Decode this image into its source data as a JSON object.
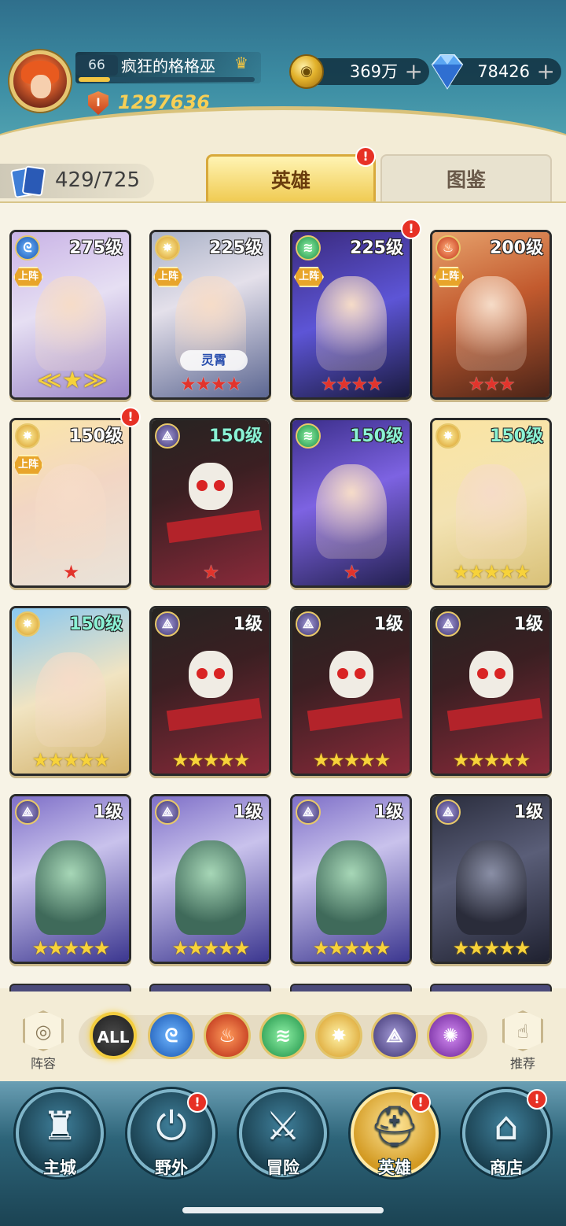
{
  "player": {
    "level": "66",
    "name": "疯狂的格格巫",
    "power": "1297636",
    "exp_fraction": 0.18
  },
  "currency": {
    "gold": "369万",
    "gems": "78426",
    "plus": "+"
  },
  "collection": {
    "count": "429/725"
  },
  "tabs": {
    "heroes": "英雄",
    "codex": "图鉴"
  },
  "badge": "!",
  "deploy_label": "上阵",
  "heroes": [
    {
      "level": "275级",
      "element": "water",
      "deployed": true,
      "stars": "",
      "star_color": "gold",
      "special": "wings",
      "alert": false
    },
    {
      "level": "225级",
      "element": "light",
      "deployed": true,
      "stars": "★★★★",
      "star_color": "red",
      "title": "灵霄",
      "alert": false
    },
    {
      "level": "225级",
      "element": "wind",
      "deployed": true,
      "stars": "★★★★",
      "star_color": "red",
      "alert": true
    },
    {
      "level": "200级",
      "element": "fire",
      "deployed": true,
      "stars": "★★★",
      "star_color": "red",
      "alert": false
    },
    {
      "level": "150级",
      "element": "light",
      "deployed": true,
      "stars": "★",
      "star_color": "red",
      "alert": true
    },
    {
      "level": "150级",
      "element": "dark",
      "deployed": false,
      "stars": "★",
      "star_color": "red",
      "alert": false
    },
    {
      "level": "150级",
      "element": "wind",
      "deployed": false,
      "stars": "★",
      "star_color": "red",
      "alert": false
    },
    {
      "level": "150级",
      "element": "light",
      "deployed": false,
      "stars": "★★★★★",
      "star_color": "gold",
      "alert": false
    },
    {
      "level": "150级",
      "element": "light",
      "deployed": false,
      "stars": "★★★★★",
      "star_color": "gold",
      "alert": false
    },
    {
      "level": "1级",
      "element": "dark",
      "deployed": false,
      "stars": "★★★★★",
      "star_color": "gold",
      "alert": false
    },
    {
      "level": "1级",
      "element": "dark",
      "deployed": false,
      "stars": "★★★★★",
      "star_color": "gold",
      "alert": false
    },
    {
      "level": "1级",
      "element": "dark",
      "deployed": false,
      "stars": "★★★★★",
      "star_color": "gold",
      "alert": false
    },
    {
      "level": "1级",
      "element": "dark",
      "deployed": false,
      "stars": "★★★★★",
      "star_color": "gold",
      "alert": false
    },
    {
      "level": "1级",
      "element": "dark",
      "deployed": false,
      "stars": "★★★★★",
      "star_color": "gold",
      "alert": false
    },
    {
      "level": "1级",
      "element": "dark",
      "deployed": false,
      "stars": "★★★★★",
      "star_color": "gold",
      "alert": false
    },
    {
      "level": "1级",
      "element": "dark",
      "deployed": false,
      "stars": "★★★★★",
      "star_color": "gold",
      "alert": false
    }
  ],
  "filters": {
    "lineup_label": "阵容",
    "all_label": "ALL",
    "recommend_label": "推荐",
    "elements": [
      "water-icon",
      "fire-icon",
      "wind-icon",
      "light-icon",
      "dark-icon",
      "arcane-icon"
    ]
  },
  "nav": {
    "main_city": "主城",
    "wild": "野外",
    "adventure": "冒险",
    "heroes": "英雄",
    "shop": "商店"
  }
}
